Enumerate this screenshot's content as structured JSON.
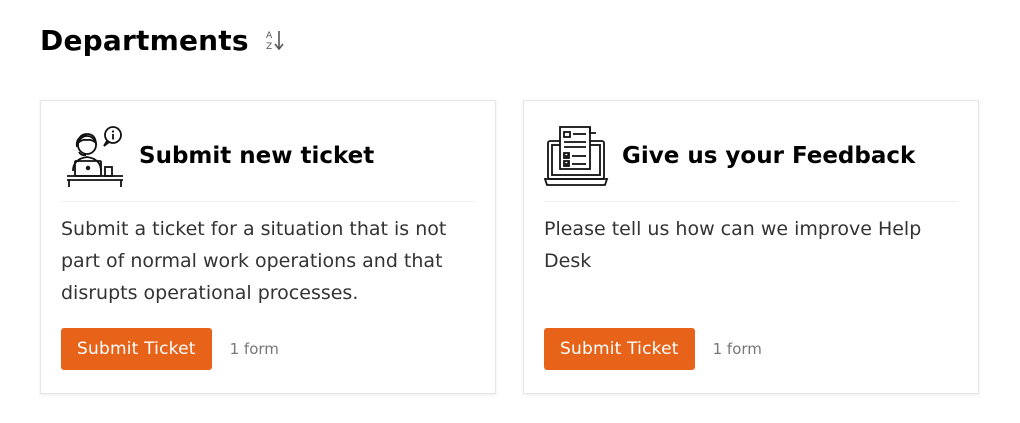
{
  "page": {
    "title": "Departments",
    "sort_icon": "sort-alpha-down-icon"
  },
  "cards": [
    {
      "icon": "support-agent-icon",
      "title": "Submit new ticket",
      "description": "Submit a ticket for a situation that is not part of normal work operations and that disrupts operational processes.",
      "button_label": "Submit Ticket",
      "form_count": "1 form"
    },
    {
      "icon": "laptop-feedback-form-icon",
      "title": "Give us your Feedback",
      "description": "Please tell us how can we improve Help Desk",
      "button_label": "Submit Ticket",
      "form_count": "1 form"
    }
  ],
  "colors": {
    "accent": "#e8631a",
    "card_border": "#e6e6e6",
    "muted_text": "#777777"
  }
}
